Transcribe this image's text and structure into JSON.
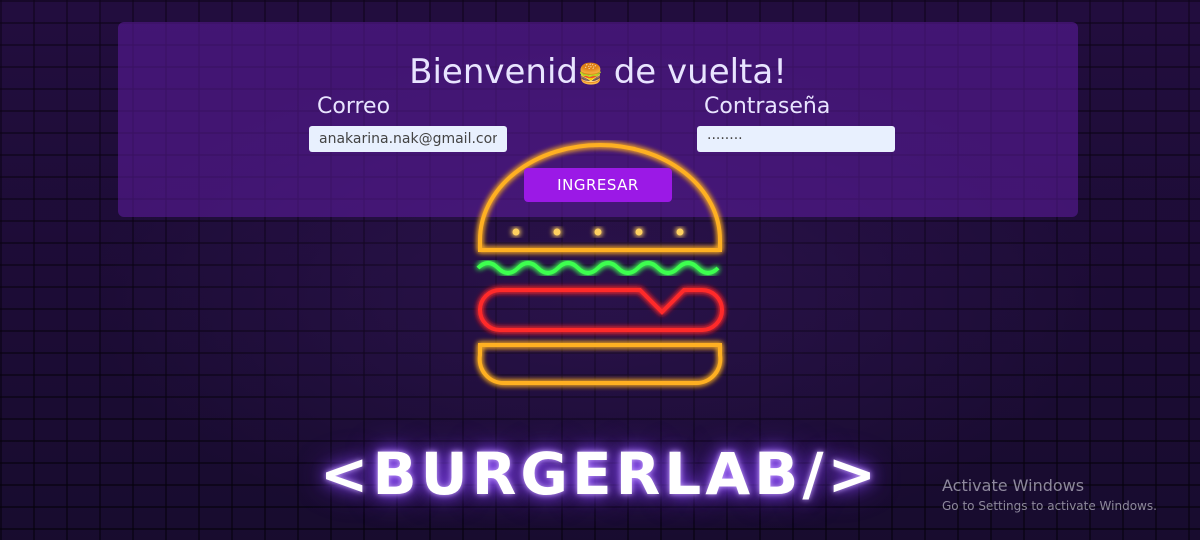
{
  "login": {
    "title": "Bienvenid",
    "title_emoji": "🍔",
    "title_end": " de vuelta!",
    "email_label": "Correo",
    "email_value": "anakarina.nak@gmail.com",
    "password_label": "Contraseña",
    "password_value": "········",
    "submit_label": "INGRESAR"
  },
  "brand": {
    "name": "<BURGERLAB/>"
  },
  "windows_watermark": {
    "title": "Activate Windows",
    "subtitle": "Go to Settings to activate Windows."
  },
  "colors": {
    "panel": "#5f1ea0",
    "button": "#9b19e6",
    "neon_bun": "#ffb020",
    "neon_lettuce": "#3cff50",
    "neon_patty": "#ff2a2a"
  }
}
